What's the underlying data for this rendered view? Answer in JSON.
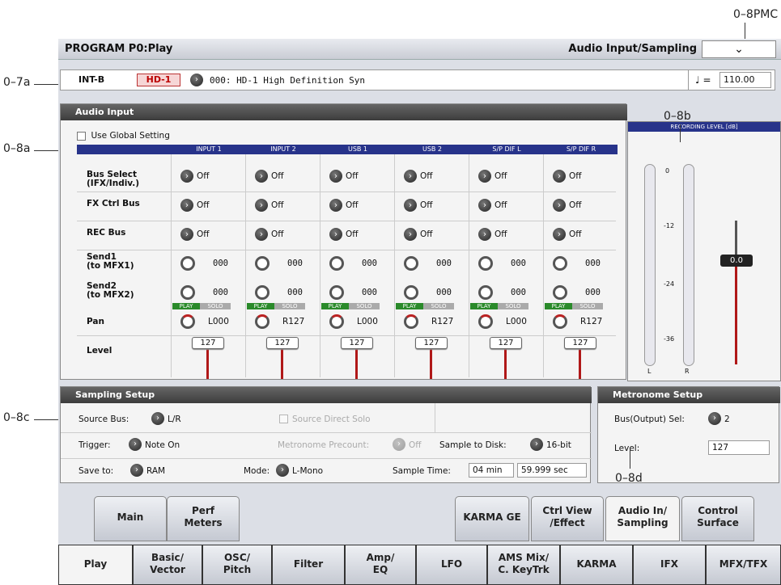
{
  "callouts": {
    "c7a": "0–7a",
    "c8a": "0–8a",
    "c8b": "0–8b",
    "c8c": "0–8c",
    "c8d": "0–8d",
    "pmc": "0–8PMC"
  },
  "header": {
    "mode_title": "PROGRAM P0:Play",
    "page_title": "Audio Input/Sampling",
    "page_menu_glyph": "⌄"
  },
  "program": {
    "bank": "INT-B",
    "badge": "HD-1",
    "name": "000: HD-1 High Definition Syn",
    "tempo_symbol": "♩ =",
    "tempo": "110.00"
  },
  "audio_input": {
    "title": "Audio Input",
    "use_global_label": "Use Global Setting",
    "use_global_checked": false,
    "columns": [
      "INPUT 1",
      "INPUT 2",
      "USB 1",
      "USB 2",
      "S/P DIF L",
      "S/P DIF R"
    ],
    "row_labels": {
      "bus_select": "Bus Select\n(IFX/Indiv.)",
      "fx_ctrl": "FX Ctrl Bus",
      "rec_bus": "REC Bus",
      "send1": "Send1\n(to MFX1)",
      "send2": "Send2\n(to MFX2)",
      "pan": "Pan",
      "level": "Level"
    },
    "bus_select": [
      "Off",
      "Off",
      "Off",
      "Off",
      "Off",
      "Off"
    ],
    "fx_ctrl": [
      "Off",
      "Off",
      "Off",
      "Off",
      "Off",
      "Off"
    ],
    "rec_bus": [
      "Off",
      "Off",
      "Off",
      "Off",
      "Off",
      "Off"
    ],
    "send1": [
      "000",
      "000",
      "000",
      "000",
      "000",
      "000"
    ],
    "send2": [
      "000",
      "000",
      "000",
      "000",
      "000",
      "000"
    ],
    "play_label": "PLAY",
    "solo_label": "SOLO",
    "pan": [
      "L000",
      "R127",
      "L000",
      "R127",
      "L000",
      "R127"
    ],
    "level": [
      "127",
      "127",
      "127",
      "127",
      "127",
      "127"
    ]
  },
  "recording_level": {
    "title": "RECORDING LEVEL [dB]",
    "ticks": [
      "0",
      "-12",
      "-24",
      "-36"
    ],
    "left_label": "L",
    "right_label": "R",
    "value": "0.0"
  },
  "sampling_setup": {
    "title": "Sampling Setup",
    "source_bus_label": "Source Bus:",
    "source_bus": "L/R",
    "source_direct_solo_label": "Source Direct Solo",
    "trigger_label": "Trigger:",
    "trigger": "Note On",
    "metronome_precount_label": "Metronome Precount:",
    "metronome_precount": "Off",
    "sample_to_disk_label": "Sample to Disk:",
    "sample_to_disk": "16-bit",
    "save_to_label": "Save to:",
    "save_to": "RAM",
    "mode_label": "Mode:",
    "mode": "L-Mono",
    "sample_time_label": "Sample Time:",
    "sample_time_min": "04 min",
    "sample_time_sec": "59.999 sec"
  },
  "metronome_setup": {
    "title": "Metronome Setup",
    "bus_label": "Bus(Output) Sel:",
    "bus": "2",
    "level_label": "Level:",
    "level": "127"
  },
  "upper_tabs": [
    {
      "l1": "Main",
      "l2": ""
    },
    {
      "l1": "Perf",
      "l2": "Meters"
    },
    {
      "l1": "KARMA GE",
      "l2": ""
    },
    {
      "l1": "Ctrl View",
      "l2": "/Effect"
    },
    {
      "l1": "Audio In/",
      "l2": "Sampling"
    },
    {
      "l1": "Control",
      "l2": "Surface"
    }
  ],
  "lower_tabs": [
    {
      "l1": "Play",
      "l2": ""
    },
    {
      "l1": "Basic/",
      "l2": "Vector"
    },
    {
      "l1": "OSC/",
      "l2": "Pitch"
    },
    {
      "l1": "Filter",
      "l2": ""
    },
    {
      "l1": "Amp/",
      "l2": "EQ"
    },
    {
      "l1": "LFO",
      "l2": ""
    },
    {
      "l1": "AMS Mix/",
      "l2": "C. KeyTrk"
    },
    {
      "l1": "KARMA",
      "l2": ""
    },
    {
      "l1": "IFX",
      "l2": ""
    },
    {
      "l1": "MFX/TFX",
      "l2": ""
    }
  ],
  "colors": {
    "header_blue": "#27338a",
    "play_green": "#2a8a2a",
    "fader_red": "#b01818",
    "badge_red": "#b00000"
  }
}
